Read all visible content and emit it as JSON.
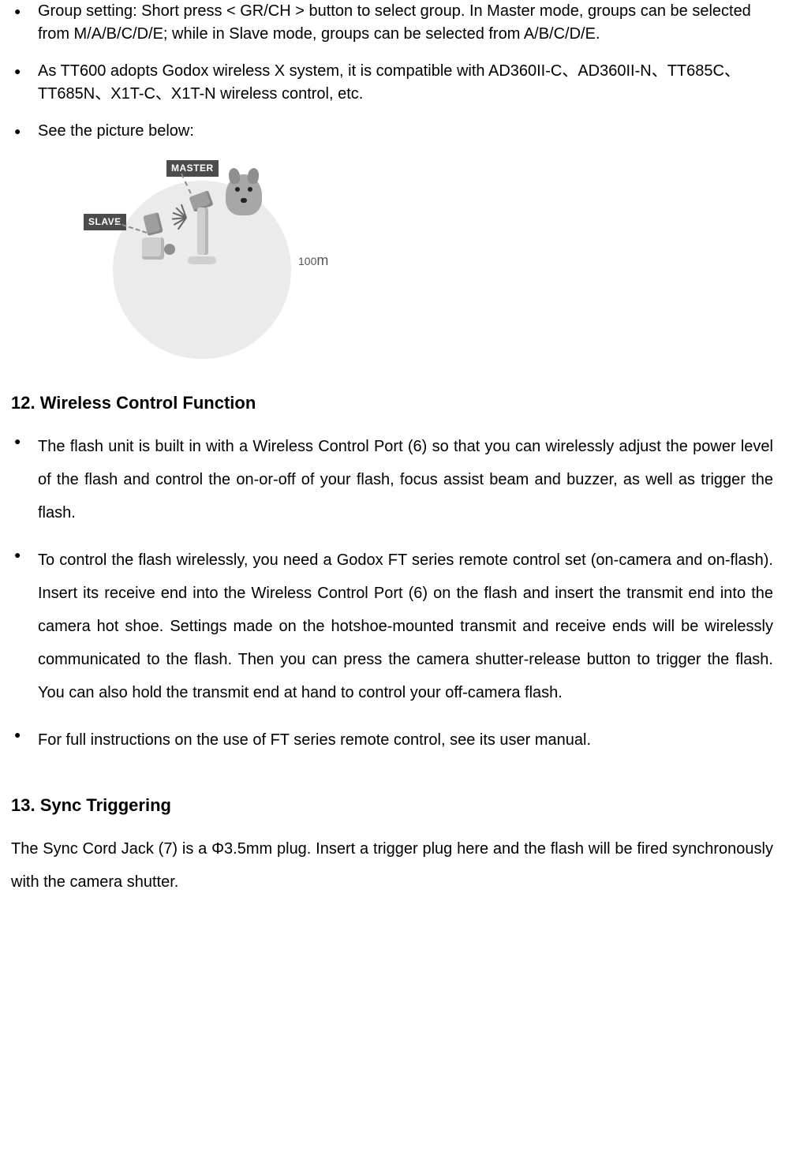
{
  "section11": {
    "bullets": [
      "Group setting: Short press < GR/CH > button to select group. In Master mode, groups can be selected from M/A/B/C/D/E; while in Slave mode, groups can be selected from A/B/C/D/E.",
      "As TT600 adopts Godox wireless X system, it is compatible with AD360II-C、AD360II-N、TT685C、TT685N、X1T-C、X1T-N wireless control, etc.",
      "See the picture below:"
    ],
    "diagram": {
      "master_label": "MASTER",
      "slave_label": "SLAVE",
      "distance_value": "100",
      "distance_unit": "m"
    }
  },
  "section12": {
    "heading": "12. Wireless Control Function",
    "bullets": [
      "The flash unit is built in with a Wireless Control Port (6) so that you can wirelessly adjust the power level of the flash and control the on-or-off of your flash, focus assist beam and buzzer, as well as trigger the flash.",
      "To control the flash wirelessly, you need a Godox FT series remote control set (on-camera and on-flash). Insert its receive end into the Wireless Control Port (6) on the flash and insert the transmit end into the camera hot shoe. Settings made on the hotshoe-mounted transmit and receive ends will be wirelessly communicated to the flash. Then you can press the camera shutter-release button to trigger the flash. You can also hold the transmit end at hand to control your off-camera flash.",
      "For full instructions on the use of FT series remote control, see its user manual."
    ]
  },
  "section13": {
    "heading": "13. Sync Triggering",
    "body": "The Sync Cord Jack (7) is a Φ3.5mm plug. Insert a trigger plug here and the flash will be fired synchronously with the camera shutter."
  }
}
